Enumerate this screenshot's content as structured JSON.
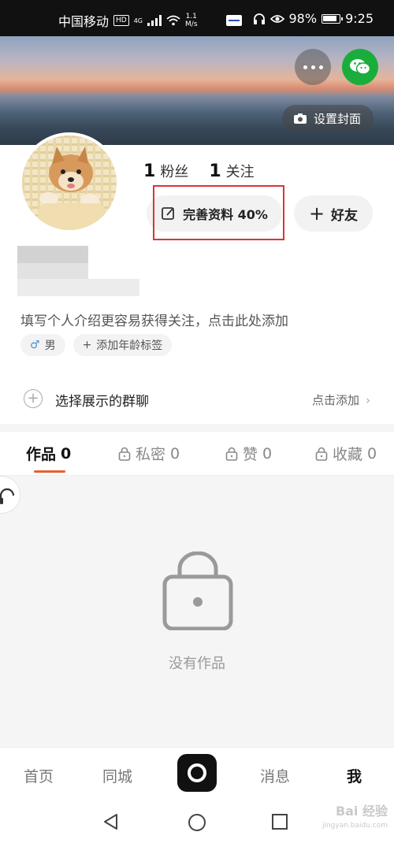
{
  "status_bar": {
    "carrier": "中国移动",
    "hd_badge": "HD",
    "network": "4G",
    "speed_value": "1.1",
    "speed_unit": "M/s",
    "battery": "98%",
    "time": "9:25"
  },
  "cover": {
    "set_cover_label": "设置封面",
    "more_icon": "more-icon",
    "share_icon": "wechat-icon"
  },
  "profile": {
    "followers_count": "1",
    "followers_label": "粉丝",
    "following_count": "1",
    "following_label": "关注",
    "complete_profile_label": "完善资料 40%",
    "add_friend_label": "好友",
    "intro_prompt": "填写个人介绍更容易获得关注，点击此处添加",
    "gender_tag": "男",
    "age_tag": "添加年龄标签",
    "group_chat_label": "选择展示的群聊",
    "group_chat_action": "点击添加"
  },
  "tabs": [
    {
      "label": "作品",
      "count": "0",
      "locked": false,
      "active": true
    },
    {
      "label": "私密",
      "count": "0",
      "locked": true,
      "active": false
    },
    {
      "label": "赞",
      "count": "0",
      "locked": true,
      "active": false
    },
    {
      "label": "收藏",
      "count": "0",
      "locked": true,
      "active": false
    }
  ],
  "empty_state": {
    "text": "没有作品"
  },
  "bottom_nav": {
    "home": "首页",
    "local": "同城",
    "messages": "消息",
    "me": "我"
  },
  "watermark": {
    "text": "Bai 经验",
    "sub": "jingyan.baidu.com"
  },
  "colors": {
    "accent": "#e8602c",
    "highlight_box": "#dd3333",
    "wechat": "#1aad3b"
  }
}
